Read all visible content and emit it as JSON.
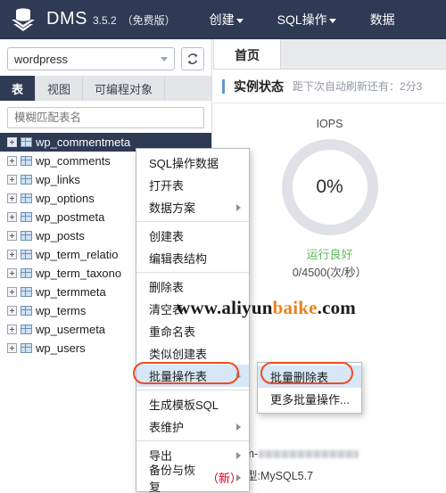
{
  "header": {
    "logo_icon": "database-stack-icon",
    "brand": "DMS",
    "version": "3.5.2",
    "edition": "（免费版）",
    "nav": [
      {
        "label": "创建",
        "has_caret": true
      },
      {
        "label": "SQL操作",
        "has_caret": true
      },
      {
        "label": "数据",
        "has_caret": false
      }
    ]
  },
  "sidebar": {
    "database_select": {
      "value": "wordpress"
    },
    "refresh_button": {
      "icon": "refresh-icon"
    },
    "tabs": [
      {
        "label": "表",
        "active": true
      },
      {
        "label": "视图",
        "active": false
      },
      {
        "label": "可编程对象",
        "active": false
      }
    ],
    "filter": {
      "placeholder": "模糊匹配表名",
      "value": ""
    },
    "tables": [
      {
        "name": "wp_commentmeta",
        "selected": true
      },
      {
        "name": "wp_comments",
        "selected": false
      },
      {
        "name": "wp_links",
        "selected": false
      },
      {
        "name": "wp_options",
        "selected": false
      },
      {
        "name": "wp_postmeta",
        "selected": false
      },
      {
        "name": "wp_posts",
        "selected": false
      },
      {
        "name": "wp_term_relatio",
        "selected": false
      },
      {
        "name": "wp_term_taxono",
        "selected": false
      },
      {
        "name": "wp_termmeta",
        "selected": false
      },
      {
        "name": "wp_terms",
        "selected": false
      },
      {
        "name": "wp_usermeta",
        "selected": false
      },
      {
        "name": "wp_users",
        "selected": false
      }
    ]
  },
  "context_menu": {
    "items": [
      {
        "label": "SQL操作数据",
        "submenu": false,
        "highlight": false
      },
      {
        "label": "打开表",
        "submenu": false,
        "highlight": false
      },
      {
        "label": "数据方案",
        "submenu": true,
        "highlight": false
      },
      {
        "separator": true
      },
      {
        "label": "创建表",
        "submenu": false,
        "highlight": false
      },
      {
        "label": "编辑表结构",
        "submenu": false,
        "highlight": false
      },
      {
        "separator": true
      },
      {
        "label": "删除表",
        "submenu": false,
        "highlight": false
      },
      {
        "label": "清空表",
        "submenu": false,
        "highlight": false
      },
      {
        "label": "重命名表",
        "submenu": false,
        "highlight": false
      },
      {
        "label": "类似创建表",
        "submenu": false,
        "highlight": false
      },
      {
        "label": "批量操作表",
        "submenu": true,
        "highlight": true
      },
      {
        "separator": true
      },
      {
        "label": "生成模板SQL",
        "submenu": false,
        "highlight": false
      },
      {
        "label": "表维护",
        "submenu": true,
        "highlight": false
      },
      {
        "separator": true
      },
      {
        "label": "导出",
        "submenu": true,
        "highlight": false
      },
      {
        "label": "备份与恢复",
        "tag": "（新）",
        "submenu": true,
        "highlight": false
      }
    ],
    "submenu": {
      "items": [
        {
          "label": "批量删除表",
          "highlight": true
        },
        {
          "label": "更多批量操作...",
          "highlight": false
        }
      ]
    }
  },
  "main": {
    "tabs": [
      {
        "label": "首页",
        "active": true
      }
    ],
    "panel": {
      "title": "实例状态",
      "refresh_note": "距下次自动刷新还有：2分3",
      "gauge": {
        "label": "IOPS",
        "percent": "0%",
        "health": "运行良好",
        "detail": "0/4500(次/秒）"
      },
      "info": {
        "instance_label": "名 :rm-",
        "db_type_label": "库类型:MySQL5.7"
      }
    }
  },
  "watermark": {
    "pre": "www.aliyun",
    "mid": "baike",
    "post": ".com"
  },
  "colors": {
    "header_bg": "#2f3b54",
    "accent_blue": "#5b9bd5",
    "highlight_ring": "#f04c1e",
    "highlight_bg": "#d7e7f7",
    "health_green": "#5fba5f",
    "ring_gray": "#dfe1e6",
    "watermark_orange": "#e8821e",
    "new_tag_red": "#d0021b"
  }
}
